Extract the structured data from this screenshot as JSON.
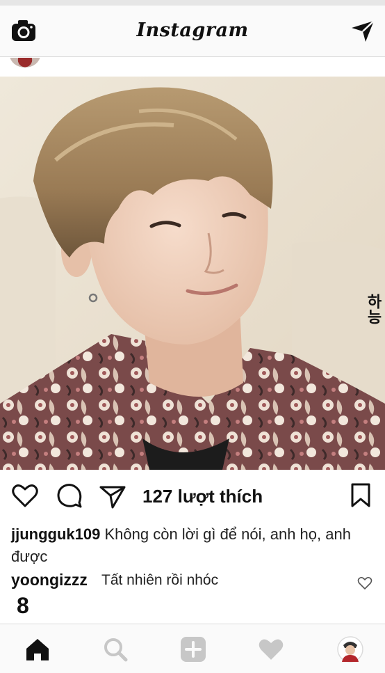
{
  "app": {
    "logo_text": "Instagram"
  },
  "top_bar": {
    "left_icon": "camera-icon",
    "right_icon": "direct-send-icon"
  },
  "post": {
    "photo_watermark": "하능",
    "likes_text": "127 lượt thích",
    "caption": {
      "username": "jjungguk109",
      "text": "Không còn lời gì để nói, anh họ, anh được"
    },
    "comments": [
      {
        "username": "yoongizzz",
        "text": "Tất nhiên rồi nhóc",
        "index": "8"
      }
    ],
    "actions": [
      "heart-icon",
      "comment-icon",
      "share-icon",
      "bookmark-icon"
    ]
  },
  "bottom_nav": {
    "items": [
      "home-icon",
      "search-icon",
      "add-icon",
      "activity-heart-icon",
      "profile-avatar"
    ],
    "active": "home-icon"
  },
  "colors": {
    "background": "#ffffff",
    "bar_background": "#fafafa",
    "divider": "#dbdbdb",
    "icon_dark": "#111111",
    "icon_muted": "#c7c7c7"
  }
}
